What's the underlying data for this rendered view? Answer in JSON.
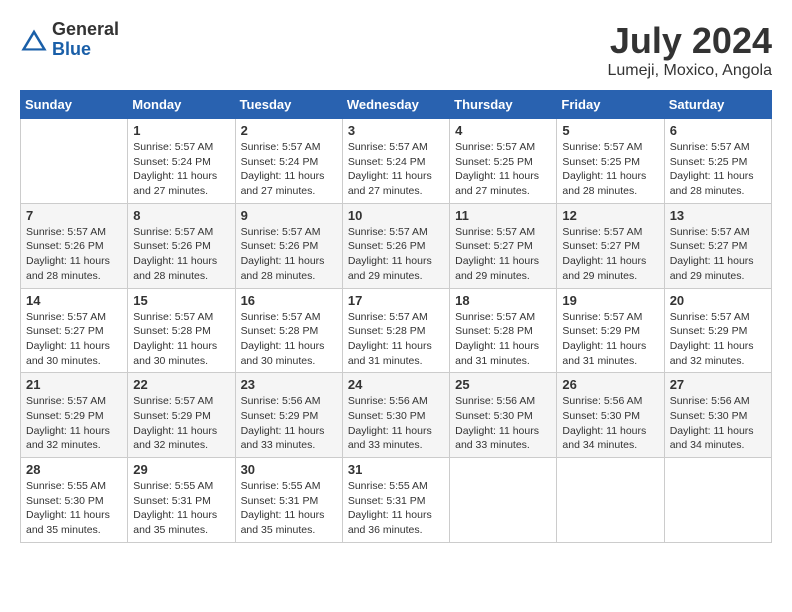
{
  "logo": {
    "general": "General",
    "blue": "Blue"
  },
  "title": "July 2024",
  "location": "Lumeji, Moxico, Angola",
  "days_of_week": [
    "Sunday",
    "Monday",
    "Tuesday",
    "Wednesday",
    "Thursday",
    "Friday",
    "Saturday"
  ],
  "weeks": [
    [
      {
        "day": "",
        "info": ""
      },
      {
        "day": "1",
        "info": "Sunrise: 5:57 AM\nSunset: 5:24 PM\nDaylight: 11 hours\nand 27 minutes."
      },
      {
        "day": "2",
        "info": "Sunrise: 5:57 AM\nSunset: 5:24 PM\nDaylight: 11 hours\nand 27 minutes."
      },
      {
        "day": "3",
        "info": "Sunrise: 5:57 AM\nSunset: 5:24 PM\nDaylight: 11 hours\nand 27 minutes."
      },
      {
        "day": "4",
        "info": "Sunrise: 5:57 AM\nSunset: 5:25 PM\nDaylight: 11 hours\nand 27 minutes."
      },
      {
        "day": "5",
        "info": "Sunrise: 5:57 AM\nSunset: 5:25 PM\nDaylight: 11 hours\nand 28 minutes."
      },
      {
        "day": "6",
        "info": "Sunrise: 5:57 AM\nSunset: 5:25 PM\nDaylight: 11 hours\nand 28 minutes."
      }
    ],
    [
      {
        "day": "7",
        "info": "Sunrise: 5:57 AM\nSunset: 5:26 PM\nDaylight: 11 hours\nand 28 minutes."
      },
      {
        "day": "8",
        "info": "Sunrise: 5:57 AM\nSunset: 5:26 PM\nDaylight: 11 hours\nand 28 minutes."
      },
      {
        "day": "9",
        "info": "Sunrise: 5:57 AM\nSunset: 5:26 PM\nDaylight: 11 hours\nand 28 minutes."
      },
      {
        "day": "10",
        "info": "Sunrise: 5:57 AM\nSunset: 5:26 PM\nDaylight: 11 hours\nand 29 minutes."
      },
      {
        "day": "11",
        "info": "Sunrise: 5:57 AM\nSunset: 5:27 PM\nDaylight: 11 hours\nand 29 minutes."
      },
      {
        "day": "12",
        "info": "Sunrise: 5:57 AM\nSunset: 5:27 PM\nDaylight: 11 hours\nand 29 minutes."
      },
      {
        "day": "13",
        "info": "Sunrise: 5:57 AM\nSunset: 5:27 PM\nDaylight: 11 hours\nand 29 minutes."
      }
    ],
    [
      {
        "day": "14",
        "info": "Sunrise: 5:57 AM\nSunset: 5:27 PM\nDaylight: 11 hours\nand 30 minutes."
      },
      {
        "day": "15",
        "info": "Sunrise: 5:57 AM\nSunset: 5:28 PM\nDaylight: 11 hours\nand 30 minutes."
      },
      {
        "day": "16",
        "info": "Sunrise: 5:57 AM\nSunset: 5:28 PM\nDaylight: 11 hours\nand 30 minutes."
      },
      {
        "day": "17",
        "info": "Sunrise: 5:57 AM\nSunset: 5:28 PM\nDaylight: 11 hours\nand 31 minutes."
      },
      {
        "day": "18",
        "info": "Sunrise: 5:57 AM\nSunset: 5:28 PM\nDaylight: 11 hours\nand 31 minutes."
      },
      {
        "day": "19",
        "info": "Sunrise: 5:57 AM\nSunset: 5:29 PM\nDaylight: 11 hours\nand 31 minutes."
      },
      {
        "day": "20",
        "info": "Sunrise: 5:57 AM\nSunset: 5:29 PM\nDaylight: 11 hours\nand 32 minutes."
      }
    ],
    [
      {
        "day": "21",
        "info": "Sunrise: 5:57 AM\nSunset: 5:29 PM\nDaylight: 11 hours\nand 32 minutes."
      },
      {
        "day": "22",
        "info": "Sunrise: 5:57 AM\nSunset: 5:29 PM\nDaylight: 11 hours\nand 32 minutes."
      },
      {
        "day": "23",
        "info": "Sunrise: 5:56 AM\nSunset: 5:29 PM\nDaylight: 11 hours\nand 33 minutes."
      },
      {
        "day": "24",
        "info": "Sunrise: 5:56 AM\nSunset: 5:30 PM\nDaylight: 11 hours\nand 33 minutes."
      },
      {
        "day": "25",
        "info": "Sunrise: 5:56 AM\nSunset: 5:30 PM\nDaylight: 11 hours\nand 33 minutes."
      },
      {
        "day": "26",
        "info": "Sunrise: 5:56 AM\nSunset: 5:30 PM\nDaylight: 11 hours\nand 34 minutes."
      },
      {
        "day": "27",
        "info": "Sunrise: 5:56 AM\nSunset: 5:30 PM\nDaylight: 11 hours\nand 34 minutes."
      }
    ],
    [
      {
        "day": "28",
        "info": "Sunrise: 5:55 AM\nSunset: 5:30 PM\nDaylight: 11 hours\nand 35 minutes."
      },
      {
        "day": "29",
        "info": "Sunrise: 5:55 AM\nSunset: 5:31 PM\nDaylight: 11 hours\nand 35 minutes."
      },
      {
        "day": "30",
        "info": "Sunrise: 5:55 AM\nSunset: 5:31 PM\nDaylight: 11 hours\nand 35 minutes."
      },
      {
        "day": "31",
        "info": "Sunrise: 5:55 AM\nSunset: 5:31 PM\nDaylight: 11 hours\nand 36 minutes."
      },
      {
        "day": "",
        "info": ""
      },
      {
        "day": "",
        "info": ""
      },
      {
        "day": "",
        "info": ""
      }
    ]
  ]
}
